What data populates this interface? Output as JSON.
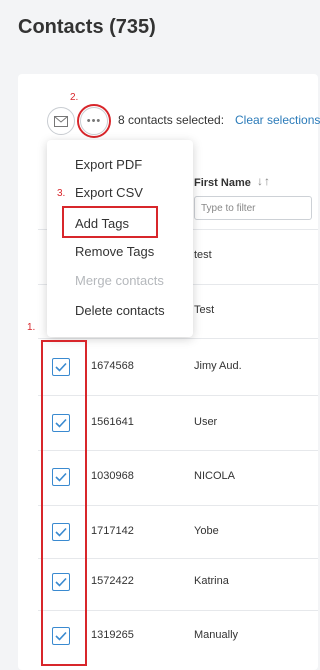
{
  "page": {
    "title": "Contacts (735)"
  },
  "toolbar": {
    "selected_text": "8 contacts selected:",
    "clear_selection": "Clear selections",
    "more_glyph": "•••",
    "mail_icon": "envelope-icon",
    "more_icon": "more-horizontal-icon"
  },
  "table": {
    "first_name_header": "First Name",
    "sort_glyph": "↓↑",
    "filter_placeholder": "Type to filter",
    "rows": [
      {
        "id": "",
        "first_name": "test",
        "checked": false
      },
      {
        "id": "",
        "first_name": "Test",
        "checked": false
      },
      {
        "id": "1674568",
        "first_name": "Jimy Aud.",
        "checked": true
      },
      {
        "id": "1561641",
        "first_name": "User",
        "checked": true
      },
      {
        "id": "1030968",
        "first_name": "NICOLA",
        "checked": true
      },
      {
        "id": "1717142",
        "first_name": "Yobe",
        "checked": true
      },
      {
        "id": "1572422",
        "first_name": "Katrina",
        "checked": true
      },
      {
        "id": "1319265",
        "first_name": "Manually",
        "checked": true
      }
    ]
  },
  "menu": {
    "items": [
      {
        "label": "Export PDF",
        "disabled": false
      },
      {
        "label": "Export CSV",
        "disabled": false
      },
      {
        "label": "Add Tags",
        "disabled": false
      },
      {
        "label": "Remove Tags",
        "disabled": false
      },
      {
        "label": "Merge contacts",
        "disabled": true
      },
      {
        "label": "Delete contacts",
        "disabled": false
      }
    ]
  },
  "annotations": {
    "step1": "1.",
    "step2": "2.",
    "step3": "3."
  },
  "colors": {
    "annotation_red": "#d8262b",
    "link_blue": "#2b7bb9",
    "checkbox_blue": "#3a8ad0"
  }
}
